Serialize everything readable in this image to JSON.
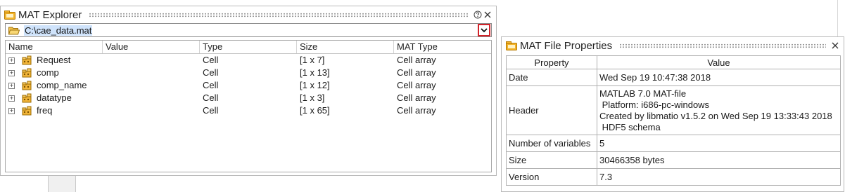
{
  "explorer": {
    "title": "MAT Explorer",
    "path": "C:\\cae_data.mat",
    "columns": [
      "Name",
      "Value",
      "Type",
      "Size",
      "MAT Type"
    ],
    "rows": [
      {
        "name": "Request",
        "value": "",
        "type": "Cell",
        "size": "[1 x 7]",
        "mat_type": "Cell array"
      },
      {
        "name": "comp",
        "value": "",
        "type": "Cell",
        "size": "[1 x 13]",
        "mat_type": "Cell array"
      },
      {
        "name": "comp_name",
        "value": "",
        "type": "Cell",
        "size": "[1 x 12]",
        "mat_type": "Cell array"
      },
      {
        "name": "datatype",
        "value": "",
        "type": "Cell",
        "size": "[1 x 3]",
        "mat_type": "Cell array"
      },
      {
        "name": "freq",
        "value": "",
        "type": "Cell",
        "size": "[1 x 65]",
        "mat_type": "Cell array"
      }
    ]
  },
  "properties": {
    "title": "MAT File Properties",
    "col_property": "Property",
    "col_value": "Value",
    "rows": [
      {
        "property": "Date",
        "value_lines": [
          "Wed Sep 19 10:47:38 2018"
        ]
      },
      {
        "property": "Header",
        "value_lines": [
          "MATLAB 7.0 MAT-file",
          " Platform: i686-pc-windows",
          "Created by libmatio v1.5.2 on Wed Sep 19 13:33:43 2018",
          " HDF5 schema"
        ]
      },
      {
        "property": "Number of variables",
        "value_lines": [
          "5"
        ]
      },
      {
        "property": "Size",
        "value_lines": [
          "30466358 bytes"
        ]
      },
      {
        "property": "Version",
        "value_lines": [
          "7.3"
        ]
      }
    ]
  },
  "icons": {
    "panel": "panel-icon",
    "folder": "folder-open-icon",
    "help": "help-icon",
    "close": "close-icon",
    "dropdown": "chevron-down-icon",
    "cell": "cell-array-icon"
  },
  "colors": {
    "dropdown_highlight": "#d2232a",
    "path_selection": "#cfe3fb",
    "panel_icon": "#e8a317"
  }
}
